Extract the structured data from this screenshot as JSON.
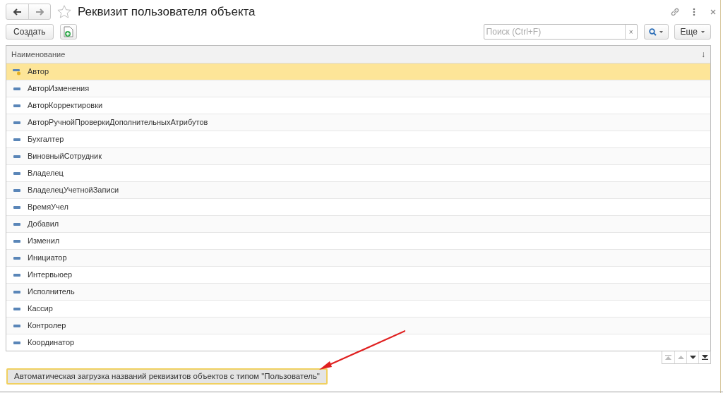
{
  "window": {
    "title": "Реквизит пользователя объекта",
    "favorite": false
  },
  "toolbar": {
    "create_button": "Создать",
    "search": {
      "placeholder": "Поиск (Ctrl+F)",
      "clear": "×"
    },
    "more_button": "Еще"
  },
  "table": {
    "columns": [
      {
        "label": "Наименование",
        "sort": "↓"
      }
    ],
    "rows": [
      {
        "name": "Автор",
        "kind": "key",
        "selected": true
      },
      {
        "name": "АвторИзменения",
        "kind": "attribute",
        "selected": false
      },
      {
        "name": "АвторКорректировки",
        "kind": "attribute",
        "selected": false
      },
      {
        "name": "АвторРучнойПроверкиДополнительныхАтрибутов",
        "kind": "attribute",
        "selected": false
      },
      {
        "name": "Бухгалтер",
        "kind": "attribute",
        "selected": false
      },
      {
        "name": "ВиновныйСотрудник",
        "kind": "attribute",
        "selected": false
      },
      {
        "name": "Владелец",
        "kind": "attribute",
        "selected": false
      },
      {
        "name": "ВладелецУчетнойЗаписи",
        "kind": "attribute",
        "selected": false
      },
      {
        "name": "ВремяУчел",
        "kind": "attribute",
        "selected": false
      },
      {
        "name": "Добавил",
        "kind": "attribute",
        "selected": false
      },
      {
        "name": "Изменил",
        "kind": "attribute",
        "selected": false
      },
      {
        "name": "Инициатор",
        "kind": "attribute",
        "selected": false
      },
      {
        "name": "Интервьюер",
        "kind": "attribute",
        "selected": false
      },
      {
        "name": "Исполнитель",
        "kind": "attribute",
        "selected": false
      },
      {
        "name": "Кассир",
        "kind": "attribute",
        "selected": false
      },
      {
        "name": "Контролер",
        "kind": "attribute",
        "selected": false
      },
      {
        "name": "Координатор",
        "kind": "attribute",
        "selected": false
      }
    ]
  },
  "load_button": {
    "label": "Автоматическая загрузка названий реквизитов объектов с типом \"Пользователь\"",
    "highlighted": true
  }
}
